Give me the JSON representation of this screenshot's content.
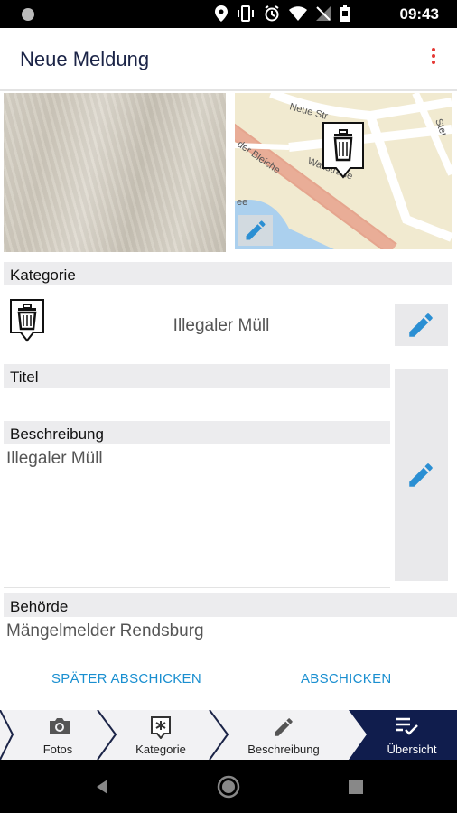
{
  "status": {
    "time": "09:43"
  },
  "appbar": {
    "title": "Neue Meldung"
  },
  "map": {
    "label_street1": "Neue Str",
    "label_street2": "Wallstraße",
    "label_street3": "der Bleiche",
    "label_street4": "Ster",
    "label_water": "ee"
  },
  "kategorie": {
    "header": "Kategorie",
    "value": "Illegaler Müll"
  },
  "titel": {
    "header": "Titel",
    "value": ""
  },
  "beschreibung": {
    "header": "Beschreibung",
    "value": "Illegaler Müll"
  },
  "behoerde": {
    "header": "Behörde",
    "value": "Mängelmelder Rendsburg"
  },
  "actions": {
    "later": "SPÄTER ABSCHICKEN",
    "send": "ABSCHICKEN"
  },
  "nav": [
    {
      "label": "Fotos",
      "icon": "camera-icon"
    },
    {
      "label": "Kategorie",
      "icon": "category-icon"
    },
    {
      "label": "Beschreibung",
      "icon": "pencil-icon"
    },
    {
      "label": "Übersicht",
      "icon": "checklist-icon"
    }
  ],
  "colors": {
    "accent": "#1a8fd0",
    "navy": "#101d4d",
    "menu_red": "#e53935",
    "header_bg": "#ececee"
  }
}
